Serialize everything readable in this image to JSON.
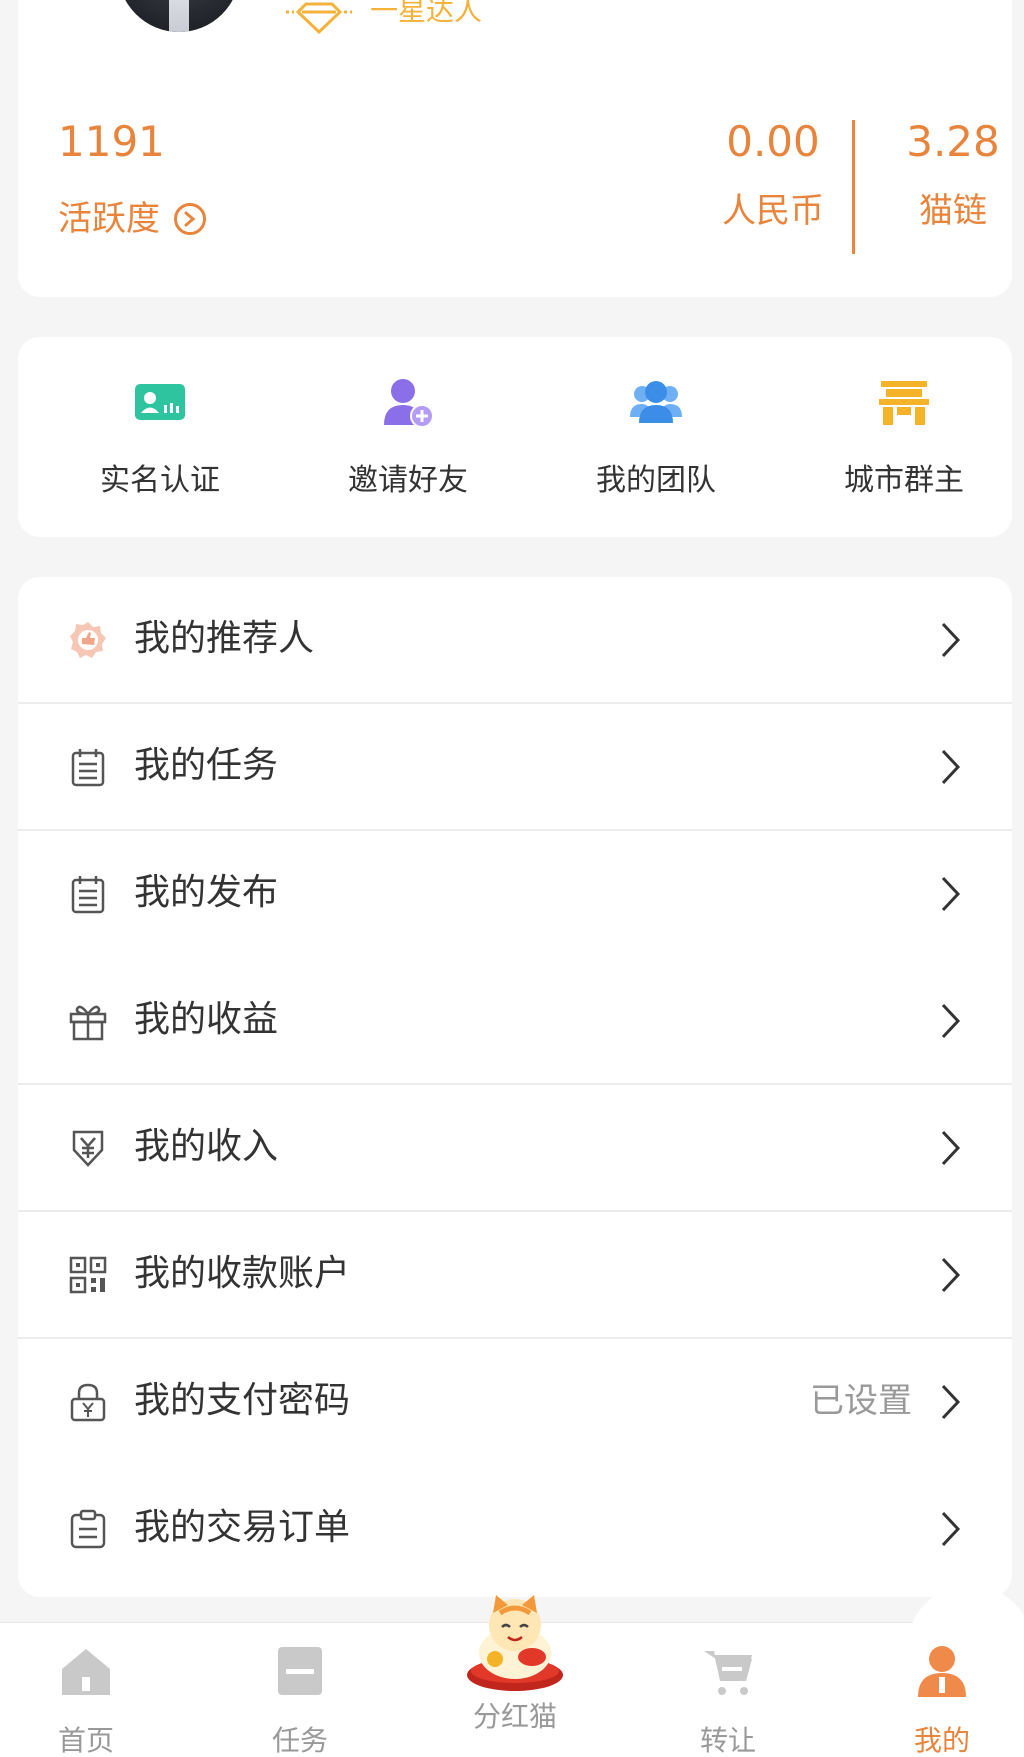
{
  "profile": {
    "level_text": "一星达人",
    "activity_value": "1191",
    "activity_label": "活跃度",
    "rmb_value": "0.00",
    "rmb_label": "人民币",
    "maolian_value": "3.28",
    "maolian_label": "猫链"
  },
  "quick_actions": [
    {
      "label": "实名认证",
      "icon": "id-card-icon",
      "color": "#2ec4a0"
    },
    {
      "label": "邀请好友",
      "icon": "add-user-icon",
      "color": "#8a6fe8"
    },
    {
      "label": "我的团队",
      "icon": "team-icon",
      "color": "#3b8de8"
    },
    {
      "label": "城市群主",
      "icon": "city-gate-icon",
      "color": "#f5b32a"
    }
  ],
  "menu": [
    {
      "label": "我的推荐人",
      "icon": "medal-icon"
    },
    {
      "label": "我的任务",
      "icon": "clipboard-icon"
    },
    {
      "label": "我的发布",
      "icon": "clipboard-icon"
    },
    {
      "label": "我的收益",
      "icon": "gift-icon"
    },
    {
      "label": "我的收入",
      "icon": "yen-shield-icon"
    },
    {
      "label": "我的收款账户",
      "icon": "qr-code-icon"
    },
    {
      "label": "我的支付密码",
      "icon": "lock-icon",
      "extra": "已设置"
    },
    {
      "label": "我的交易订单",
      "icon": "order-icon"
    }
  ],
  "nav": [
    {
      "label": "首页",
      "icon": "home-icon"
    },
    {
      "label": "任务",
      "icon": "task-icon"
    },
    {
      "label": "分红猫",
      "icon": "lucky-cat-icon"
    },
    {
      "label": "转让",
      "icon": "cart-icon"
    },
    {
      "label": "我的",
      "icon": "profile-icon",
      "active": true
    }
  ],
  "colors": {
    "accent": "#e8843c",
    "gold": "#f5b23b"
  }
}
